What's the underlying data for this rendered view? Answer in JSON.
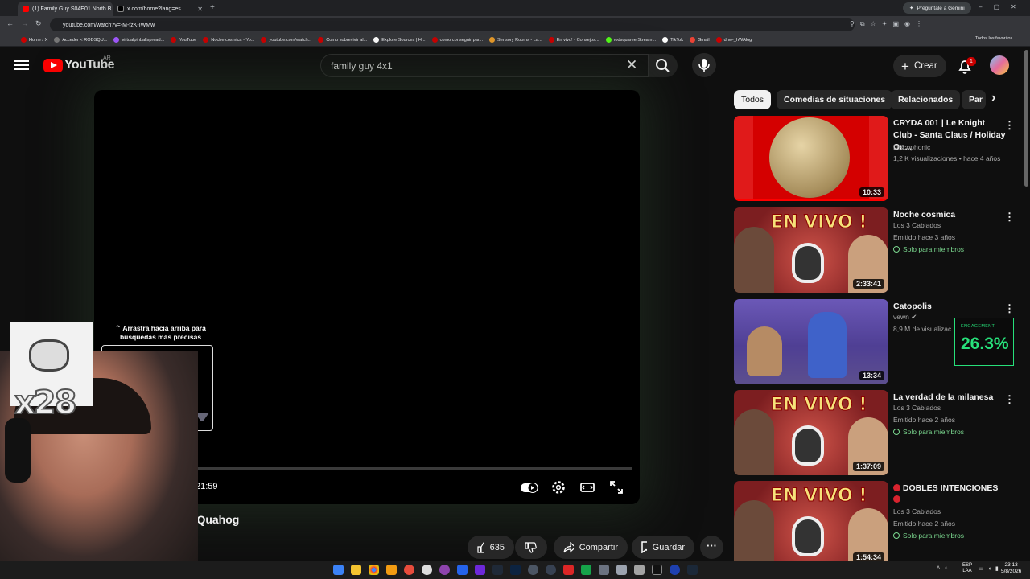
{
  "browser": {
    "tabs": [
      {
        "title": "(1) Family Guy S04E01 North B"
      },
      {
        "title": "x.com/home?lang=es"
      }
    ],
    "url": "youtube.com/watch?v=-M-fzK-IWMw",
    "gemini_label": "Pregúntale a Gemini",
    "bookmarks": [
      "Home / X",
      "Acceder < RODSQU...",
      "virtualpinballspread...",
      "YouTube",
      "Noche cosmica - Yo...",
      "youtube.com/watch...",
      "Como sobrevivir al...",
      "Explore Sources | H...",
      "como conseguir par...",
      "Sensory Rooms - La...",
      "En vivo! - Consejos...",
      "rodsquaree Stream...",
      "TikTok",
      "Gmail",
      "dnw-_hWAlog"
    ],
    "bookmarks_all": "Todos los favoritos"
  },
  "youtube": {
    "logo_text": "YouTube",
    "country": "AR",
    "search_value": "family guy 4x1",
    "create_label": "Crear",
    "notification_count": "1"
  },
  "player": {
    "duration": "21:59",
    "drag_hint_line1": "Arrastra hacia arriba para",
    "drag_hint_line2": "búsquedas más precisas",
    "progress_fraction": 0.0
  },
  "video": {
    "title_visible": "h Quahog",
    "likes": "635",
    "share_label": "Compartir",
    "save_label": "Guardar"
  },
  "chips": [
    "Todos",
    "Comedias de situaciones",
    "Relacionados",
    "Par"
  ],
  "recommendations": [
    {
      "title": "CRYDA 001 | Le Knight Club - Santa Claus / Holiday On...",
      "channel": "Discophonic",
      "meta": "1,2 K visualizaciones • hace 4 años",
      "duration": "10:33",
      "members": ""
    },
    {
      "title": "Noche cosmica",
      "channel": "Los 3 Cabiados",
      "meta": "Emitido hace 3 años",
      "duration": "2:33:41",
      "members": "Solo para miembros"
    },
    {
      "title": "Catopolis",
      "channel": "vewn",
      "meta": "8,9 M de visualizac",
      "duration": "13:34",
      "members": ""
    },
    {
      "title": "La verdad de la milanesa",
      "channel": "Los 3 Cabiados",
      "meta": "Emitido hace 2 años",
      "duration": "1:37:09",
      "members": "Solo para miembros"
    },
    {
      "title": "DOBLES INTENCIONES",
      "channel": "Los 3 Cabiados",
      "meta": "Emitido hace 2 años",
      "duration": "1:54:34",
      "members": "Solo para miembros"
    }
  ],
  "thumb_text": "EN VIVO !",
  "overlay": {
    "engagement_label": "ENGAGEMENT",
    "engagement_value": "26.3%",
    "sticker_text": "x28"
  },
  "taskbar": {
    "lang_line1": "ESP",
    "lang_line2": "LAA",
    "time": "23:13",
    "date": "5/8/2026"
  },
  "colors": {
    "accent": "#ff0000",
    "engagement": "#27e07a",
    "members": "#7bd88f"
  }
}
